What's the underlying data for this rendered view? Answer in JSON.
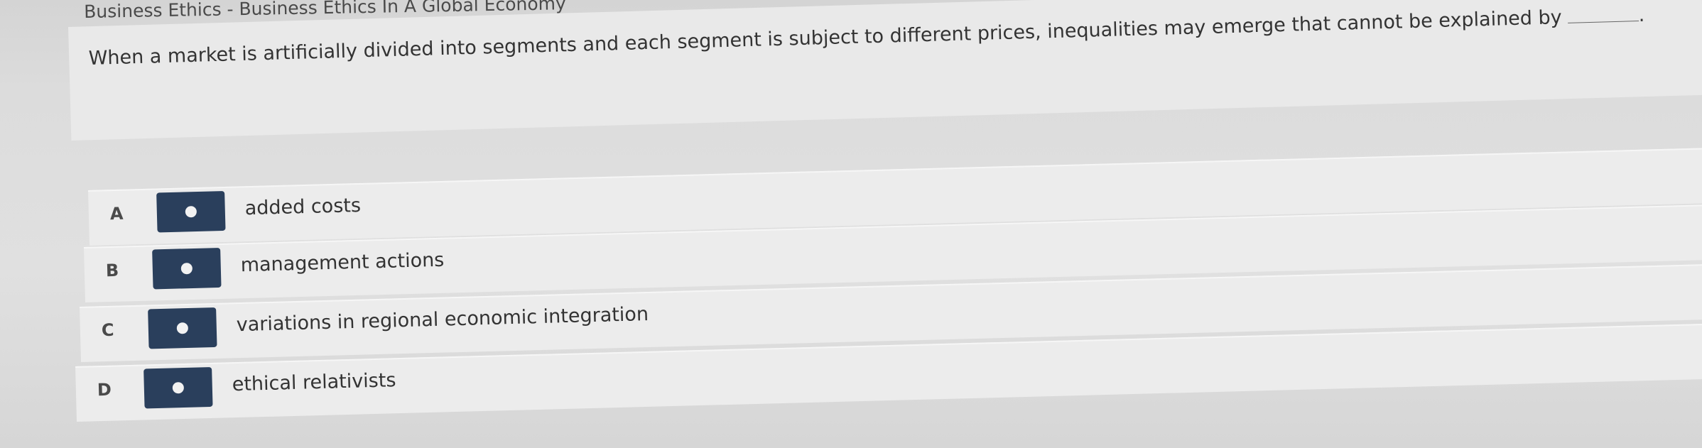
{
  "header": {
    "breadcrumb": "Business Ethics - Business Ethics In A Global Economy"
  },
  "question": {
    "text": "When a market is artificially divided into segments and each segment is subject to different prices, inequalities may emerge that cannot be explained by",
    "suffix": "."
  },
  "options": [
    {
      "letter": "A",
      "text": "added costs"
    },
    {
      "letter": "B",
      "text": "management actions"
    },
    {
      "letter": "C",
      "text": "variations in regional economic integration"
    },
    {
      "letter": "D",
      "text": "ethical relativists"
    }
  ],
  "colors": {
    "radio_bg": "#2a3f5c",
    "radio_dot": "#f2f2f2",
    "panel_bg": "#e9e9e9"
  }
}
